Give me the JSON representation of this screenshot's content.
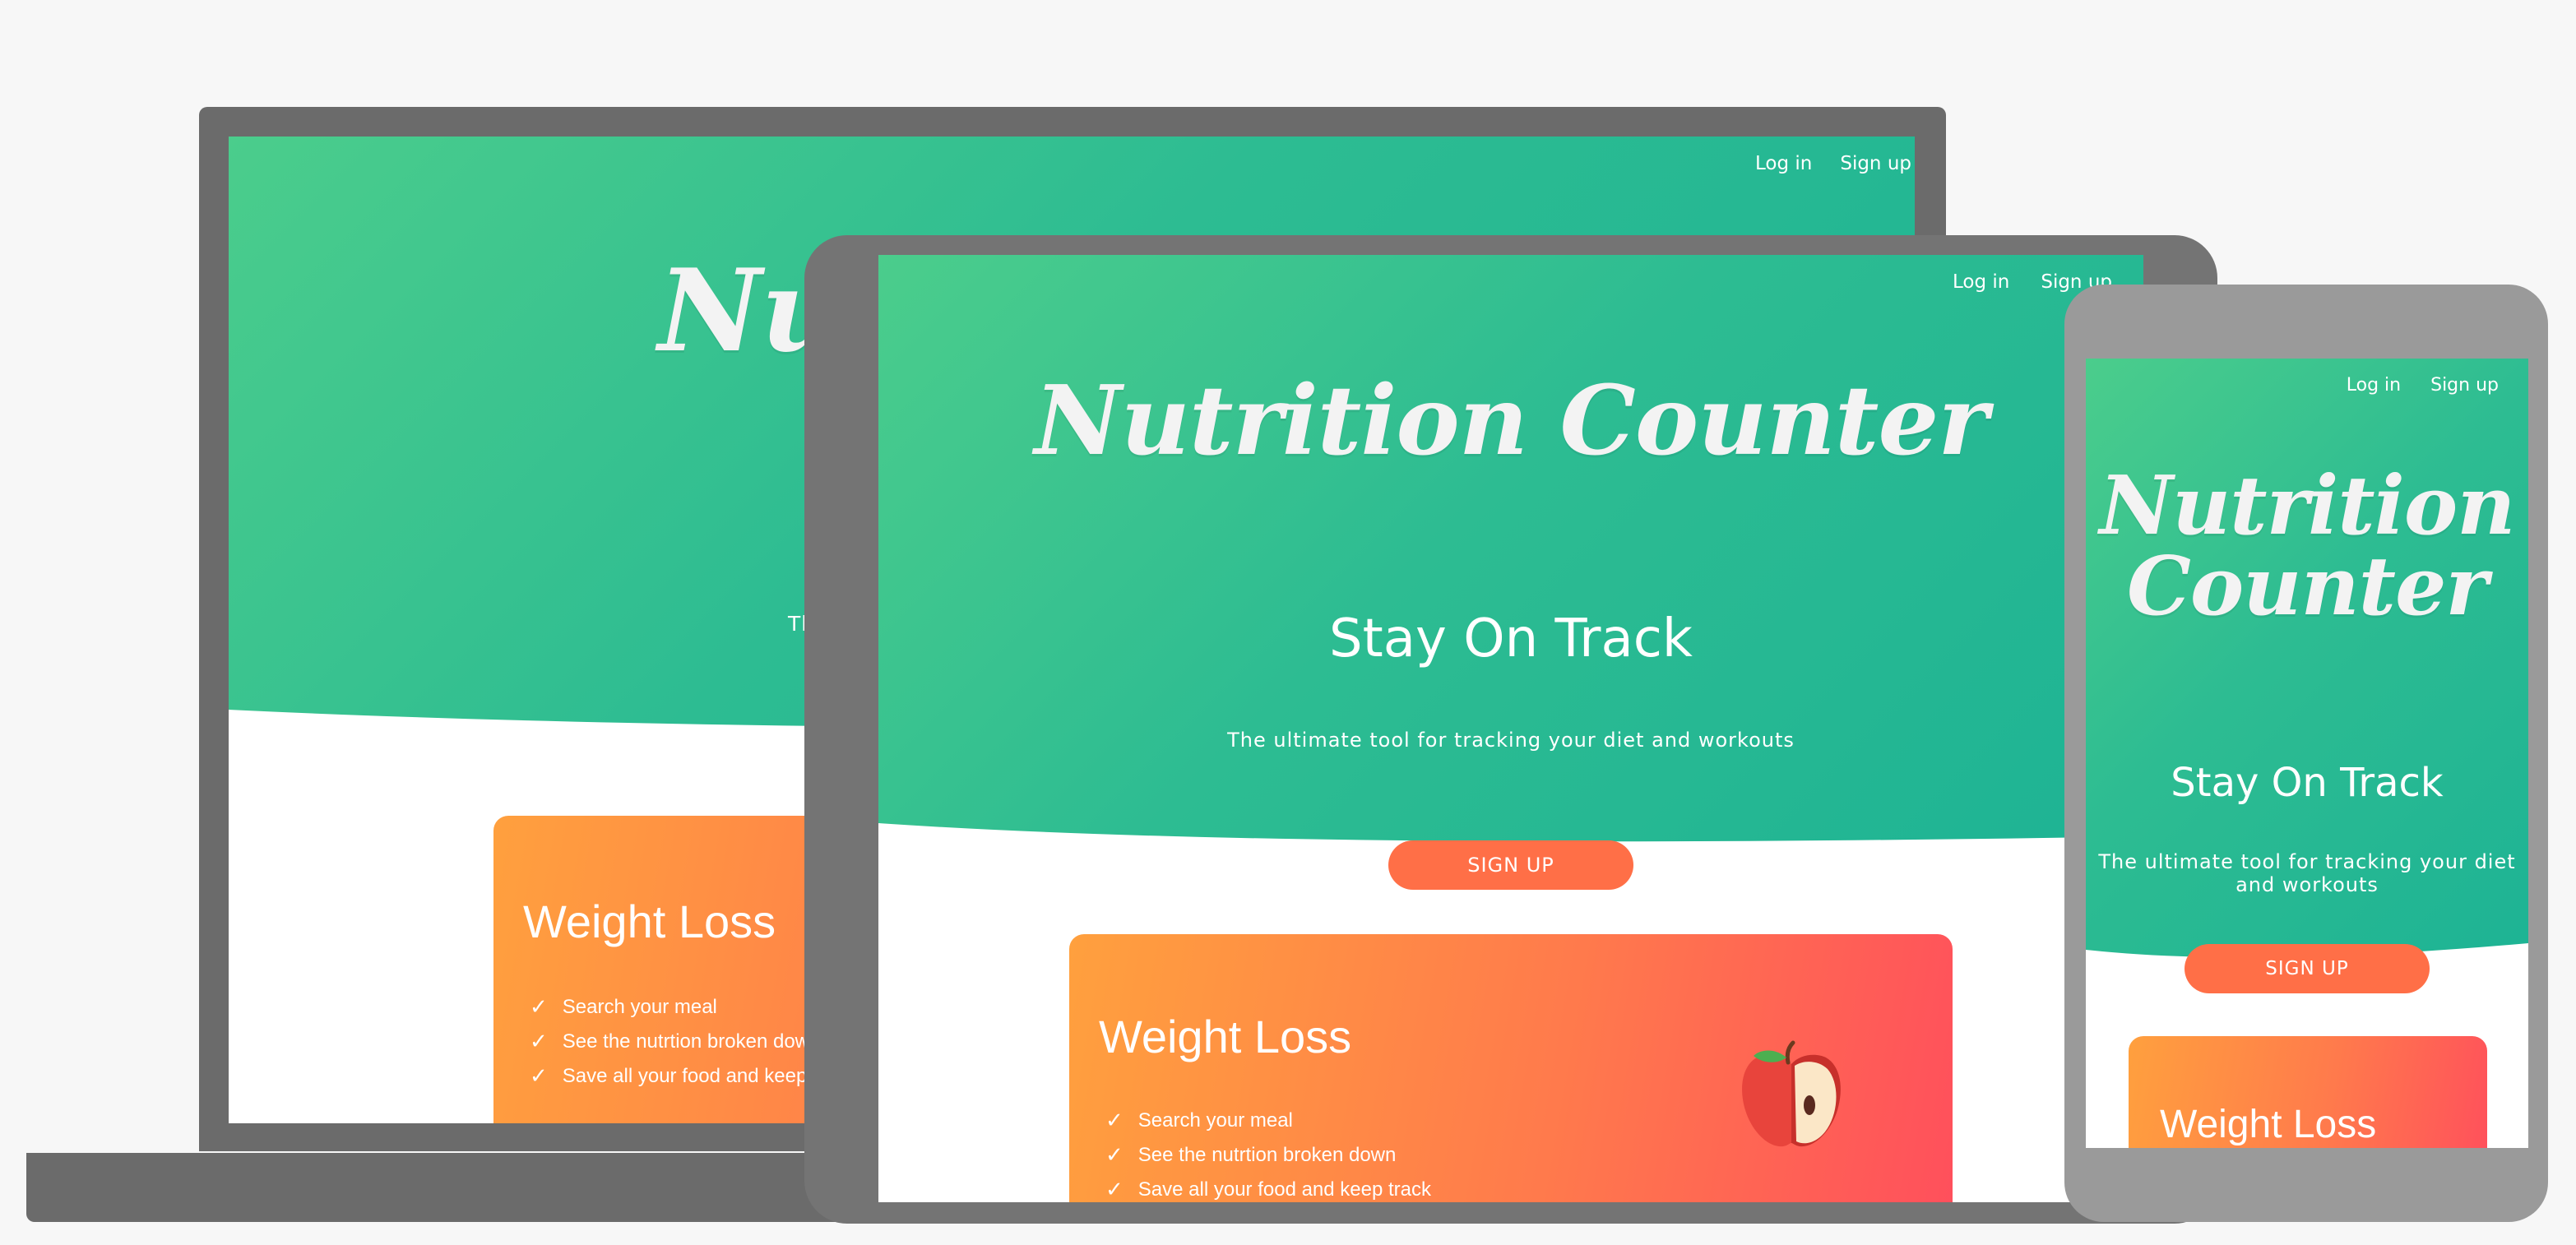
{
  "nav": {
    "login": "Log in",
    "signup": "Sign up"
  },
  "hero": {
    "brand": "Nutrition Counter",
    "brand_line1": "Nutrition",
    "brand_line2": "Counter",
    "tagline": "Stay On Track",
    "subtitle": "The ultimate tool for tracking your diet and workouts",
    "cta": "SIGN UP"
  },
  "laptop": {
    "brand_visible": "Nu",
    "subtitle_visible": "Th",
    "features_visible": [
      "Search your meal",
      "See the nutrtion broken dow",
      "Save all your food and keep"
    ]
  },
  "card": {
    "title": "Weight Loss",
    "features": [
      "Search your meal",
      "See the nutrtion broken down",
      "Save all your food and keep track"
    ],
    "icon": "apple-icon"
  },
  "colors": {
    "hero_gradient_start": "#4bcd8c",
    "hero_gradient_end": "#1db394",
    "cta": "#ff6f47",
    "card_gradient_start": "#ffa03e",
    "card_gradient_end": "#ff4f5c",
    "device_frame": "#6b6b6b"
  }
}
